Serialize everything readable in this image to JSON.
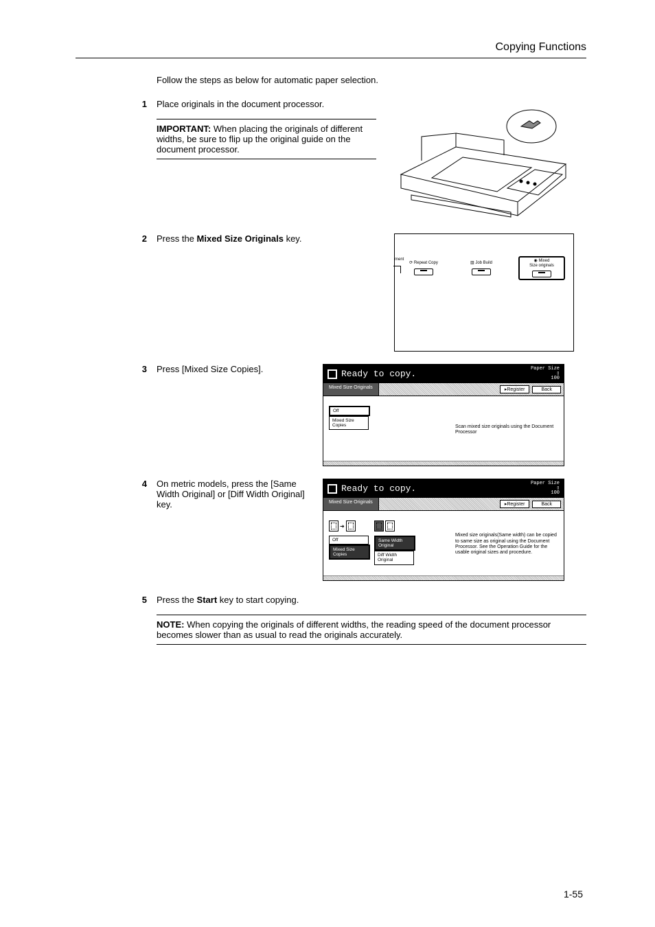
{
  "header": {
    "chapter_title": "Copying Functions"
  },
  "intro": "Follow the steps as below for automatic paper selection.",
  "steps": {
    "s1": {
      "num": "1",
      "text": "Place originals in the document processor.",
      "important_label": "IMPORTANT:",
      "important_text": " When placing the originals of different widths, be sure to flip up the original guide on the document processor."
    },
    "s2": {
      "num": "2",
      "pre": "Press the ",
      "bold": "Mixed Size Originals",
      "post": " key."
    },
    "s3": {
      "num": "3",
      "text": "Press [Mixed Size Copies]."
    },
    "s4": {
      "num": "4",
      "text": "On metric models, press the [Same Width Original] or [Diff Width Original] key."
    },
    "s5": {
      "num": "5",
      "pre": "Press the ",
      "bold": "Start",
      "post": " key to start copying.",
      "note_label": "NOTE:",
      "note_text": " When copying the originals of different widths, the reading speed of the document processor becomes slower than as usual to read the originals accurately."
    }
  },
  "hwpanel": {
    "frag": "ment",
    "k1": "Repeat Copy",
    "k2": "Job Build",
    "k3a": "Mixed",
    "k3b": "Size originals"
  },
  "screen1": {
    "title": "Ready to copy.",
    "paper_size": "Paper Size",
    "count": "100",
    "tab": "Mixed Size Originals",
    "register": "Register",
    "back": "Back",
    "btn_off": "Off",
    "btn_mixed": "Mixed Size\nCopies",
    "desc": "Scan mixed size originals using the Document Processor"
  },
  "screen2": {
    "title": "Ready to copy.",
    "paper_size": "Paper Size",
    "count": "100",
    "tab": "Mixed Size Originals",
    "register": "Register",
    "back": "Back",
    "btn_off": "Off",
    "btn_mixed": "Mixed Size\nCopies",
    "btn_same": "Same Width\nOriginal",
    "btn_diff": "Diff Width\nOriginal",
    "desc": "Mixed size originals(Same width) can be copied to same size as original using the Document Processor. See the Operation Guide for the usable original sizes and procedure."
  },
  "page_number": "1-55"
}
